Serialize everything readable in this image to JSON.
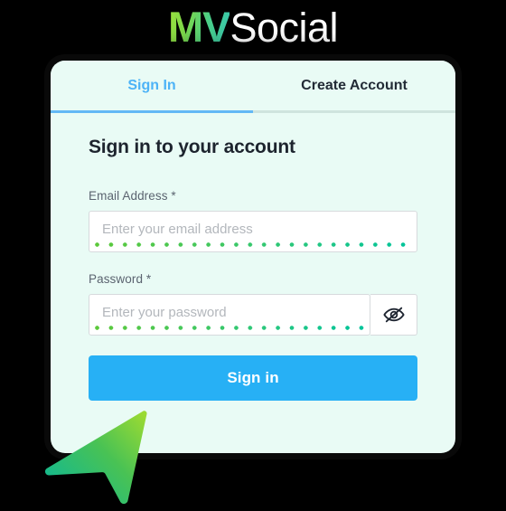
{
  "brand": {
    "mark": "MV",
    "name": "Social",
    "gradient_start": "#9ee23c",
    "gradient_end": "#36c6b2",
    "name_color": "#ffffff"
  },
  "card": {
    "background": "#e9fbf5",
    "tabs": [
      {
        "id": "sign-in",
        "label": "Sign In",
        "active": true,
        "color": "#4db3f7",
        "underline_color": "#63b8f5"
      },
      {
        "id": "create-account",
        "label": "Create Account",
        "active": false,
        "color": "#222b36",
        "underline_color": "#cfe4de"
      }
    ],
    "form": {
      "title": "Sign in to your account",
      "fields": [
        {
          "id": "email",
          "label": "Email Address *",
          "value": "",
          "placeholder": "Enter your email address",
          "accent_start": "#5cc93a",
          "accent_end": "#00c49b"
        },
        {
          "id": "password",
          "label": "Password *",
          "value": "",
          "placeholder": "Enter your password",
          "accent_start": "#5cc93a",
          "accent_end": "#00c49b",
          "toggle_icon": "eye-off-icon"
        }
      ],
      "submit": {
        "label": "Sign in",
        "color": "#27b0f5",
        "text_color": "#ffffff"
      }
    }
  },
  "cursor": {
    "icon": "pointer-arrow-icon",
    "gradient_start": "#8fd43a",
    "gradient_end": "#19b98a"
  }
}
